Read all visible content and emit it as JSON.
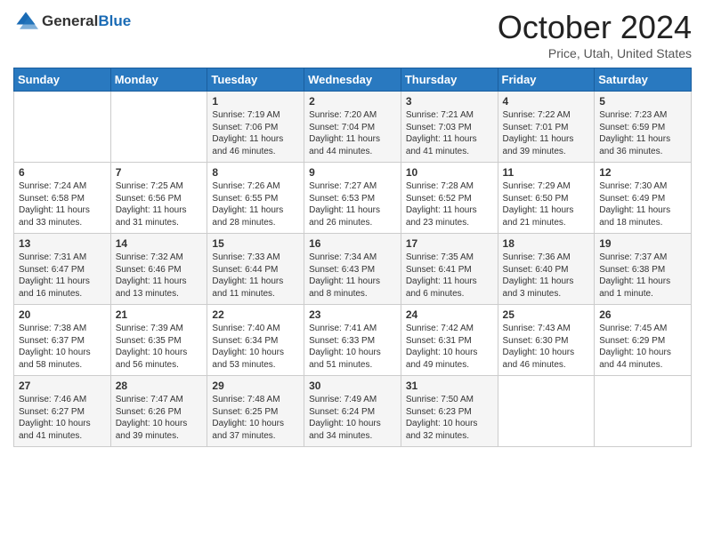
{
  "header": {
    "logo_general": "General",
    "logo_blue": "Blue",
    "month_title": "October 2024",
    "location": "Price, Utah, United States"
  },
  "days_of_week": [
    "Sunday",
    "Monday",
    "Tuesday",
    "Wednesday",
    "Thursday",
    "Friday",
    "Saturday"
  ],
  "weeks": [
    [
      {
        "day": "",
        "sunrise": "",
        "sunset": "",
        "daylight": ""
      },
      {
        "day": "",
        "sunrise": "",
        "sunset": "",
        "daylight": ""
      },
      {
        "day": "1",
        "sunrise": "Sunrise: 7:19 AM",
        "sunset": "Sunset: 7:06 PM",
        "daylight": "Daylight: 11 hours and 46 minutes."
      },
      {
        "day": "2",
        "sunrise": "Sunrise: 7:20 AM",
        "sunset": "Sunset: 7:04 PM",
        "daylight": "Daylight: 11 hours and 44 minutes."
      },
      {
        "day": "3",
        "sunrise": "Sunrise: 7:21 AM",
        "sunset": "Sunset: 7:03 PM",
        "daylight": "Daylight: 11 hours and 41 minutes."
      },
      {
        "day": "4",
        "sunrise": "Sunrise: 7:22 AM",
        "sunset": "Sunset: 7:01 PM",
        "daylight": "Daylight: 11 hours and 39 minutes."
      },
      {
        "day": "5",
        "sunrise": "Sunrise: 7:23 AM",
        "sunset": "Sunset: 6:59 PM",
        "daylight": "Daylight: 11 hours and 36 minutes."
      }
    ],
    [
      {
        "day": "6",
        "sunrise": "Sunrise: 7:24 AM",
        "sunset": "Sunset: 6:58 PM",
        "daylight": "Daylight: 11 hours and 33 minutes."
      },
      {
        "day": "7",
        "sunrise": "Sunrise: 7:25 AM",
        "sunset": "Sunset: 6:56 PM",
        "daylight": "Daylight: 11 hours and 31 minutes."
      },
      {
        "day": "8",
        "sunrise": "Sunrise: 7:26 AM",
        "sunset": "Sunset: 6:55 PM",
        "daylight": "Daylight: 11 hours and 28 minutes."
      },
      {
        "day": "9",
        "sunrise": "Sunrise: 7:27 AM",
        "sunset": "Sunset: 6:53 PM",
        "daylight": "Daylight: 11 hours and 26 minutes."
      },
      {
        "day": "10",
        "sunrise": "Sunrise: 7:28 AM",
        "sunset": "Sunset: 6:52 PM",
        "daylight": "Daylight: 11 hours and 23 minutes."
      },
      {
        "day": "11",
        "sunrise": "Sunrise: 7:29 AM",
        "sunset": "Sunset: 6:50 PM",
        "daylight": "Daylight: 11 hours and 21 minutes."
      },
      {
        "day": "12",
        "sunrise": "Sunrise: 7:30 AM",
        "sunset": "Sunset: 6:49 PM",
        "daylight": "Daylight: 11 hours and 18 minutes."
      }
    ],
    [
      {
        "day": "13",
        "sunrise": "Sunrise: 7:31 AM",
        "sunset": "Sunset: 6:47 PM",
        "daylight": "Daylight: 11 hours and 16 minutes."
      },
      {
        "day": "14",
        "sunrise": "Sunrise: 7:32 AM",
        "sunset": "Sunset: 6:46 PM",
        "daylight": "Daylight: 11 hours and 13 minutes."
      },
      {
        "day": "15",
        "sunrise": "Sunrise: 7:33 AM",
        "sunset": "Sunset: 6:44 PM",
        "daylight": "Daylight: 11 hours and 11 minutes."
      },
      {
        "day": "16",
        "sunrise": "Sunrise: 7:34 AM",
        "sunset": "Sunset: 6:43 PM",
        "daylight": "Daylight: 11 hours and 8 minutes."
      },
      {
        "day": "17",
        "sunrise": "Sunrise: 7:35 AM",
        "sunset": "Sunset: 6:41 PM",
        "daylight": "Daylight: 11 hours and 6 minutes."
      },
      {
        "day": "18",
        "sunrise": "Sunrise: 7:36 AM",
        "sunset": "Sunset: 6:40 PM",
        "daylight": "Daylight: 11 hours and 3 minutes."
      },
      {
        "day": "19",
        "sunrise": "Sunrise: 7:37 AM",
        "sunset": "Sunset: 6:38 PM",
        "daylight": "Daylight: 11 hours and 1 minute."
      }
    ],
    [
      {
        "day": "20",
        "sunrise": "Sunrise: 7:38 AM",
        "sunset": "Sunset: 6:37 PM",
        "daylight": "Daylight: 10 hours and 58 minutes."
      },
      {
        "day": "21",
        "sunrise": "Sunrise: 7:39 AM",
        "sunset": "Sunset: 6:35 PM",
        "daylight": "Daylight: 10 hours and 56 minutes."
      },
      {
        "day": "22",
        "sunrise": "Sunrise: 7:40 AM",
        "sunset": "Sunset: 6:34 PM",
        "daylight": "Daylight: 10 hours and 53 minutes."
      },
      {
        "day": "23",
        "sunrise": "Sunrise: 7:41 AM",
        "sunset": "Sunset: 6:33 PM",
        "daylight": "Daylight: 10 hours and 51 minutes."
      },
      {
        "day": "24",
        "sunrise": "Sunrise: 7:42 AM",
        "sunset": "Sunset: 6:31 PM",
        "daylight": "Daylight: 10 hours and 49 minutes."
      },
      {
        "day": "25",
        "sunrise": "Sunrise: 7:43 AM",
        "sunset": "Sunset: 6:30 PM",
        "daylight": "Daylight: 10 hours and 46 minutes."
      },
      {
        "day": "26",
        "sunrise": "Sunrise: 7:45 AM",
        "sunset": "Sunset: 6:29 PM",
        "daylight": "Daylight: 10 hours and 44 minutes."
      }
    ],
    [
      {
        "day": "27",
        "sunrise": "Sunrise: 7:46 AM",
        "sunset": "Sunset: 6:27 PM",
        "daylight": "Daylight: 10 hours and 41 minutes."
      },
      {
        "day": "28",
        "sunrise": "Sunrise: 7:47 AM",
        "sunset": "Sunset: 6:26 PM",
        "daylight": "Daylight: 10 hours and 39 minutes."
      },
      {
        "day": "29",
        "sunrise": "Sunrise: 7:48 AM",
        "sunset": "Sunset: 6:25 PM",
        "daylight": "Daylight: 10 hours and 37 minutes."
      },
      {
        "day": "30",
        "sunrise": "Sunrise: 7:49 AM",
        "sunset": "Sunset: 6:24 PM",
        "daylight": "Daylight: 10 hours and 34 minutes."
      },
      {
        "day": "31",
        "sunrise": "Sunrise: 7:50 AM",
        "sunset": "Sunset: 6:23 PM",
        "daylight": "Daylight: 10 hours and 32 minutes."
      },
      {
        "day": "",
        "sunrise": "",
        "sunset": "",
        "daylight": ""
      },
      {
        "day": "",
        "sunrise": "",
        "sunset": "",
        "daylight": ""
      }
    ]
  ]
}
